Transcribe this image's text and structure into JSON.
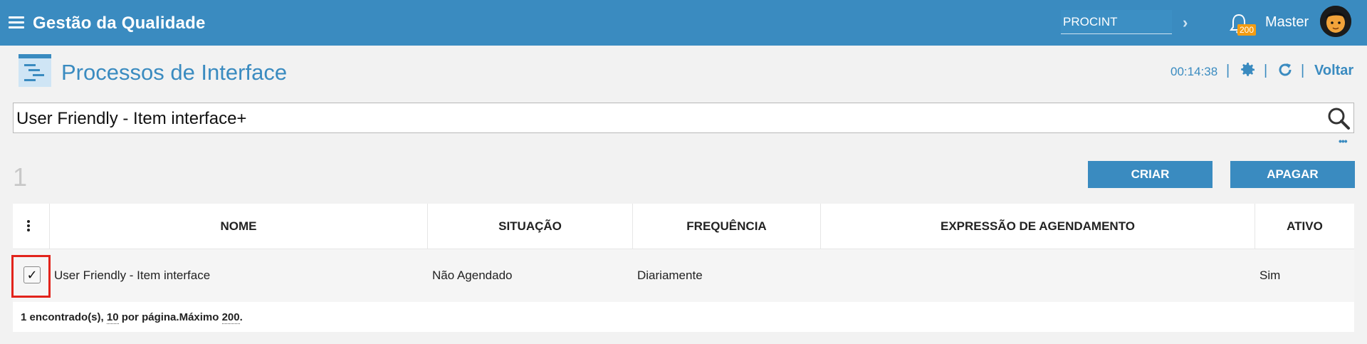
{
  "header": {
    "app_title": "Gestão da Qualidade",
    "search_value": "PROCINT",
    "notification_count": "200",
    "user_name": "Master"
  },
  "page": {
    "title": "Processos de Interface",
    "timer": "00:14:38",
    "back_label": "Voltar"
  },
  "filter": {
    "value": "User Friendly - Item interface+"
  },
  "toolbar": {
    "record_count": "1",
    "create_label": "CRIAR",
    "delete_label": "APAGAR"
  },
  "table": {
    "columns": [
      "NOME",
      "SITUAÇÃO",
      "FREQUÊNCIA",
      "EXPRESSÃO DE AGENDAMENTO",
      "ATIVO"
    ],
    "rows": [
      {
        "checked": "✓",
        "nome": "User Friendly - Item interface",
        "situacao": "Não Agendado",
        "frequencia": "Diariamente",
        "expressao": "",
        "ativo": "Sim"
      }
    ],
    "footer": {
      "found": "1",
      "found_text": "encontrado(s),",
      "per_page": "10",
      "per_page_text": "por página.Máximo",
      "max": "200",
      "end": "."
    }
  },
  "colors": {
    "primary": "#3a8bc0",
    "badge": "#f39c12",
    "highlight": "#e2241c"
  }
}
